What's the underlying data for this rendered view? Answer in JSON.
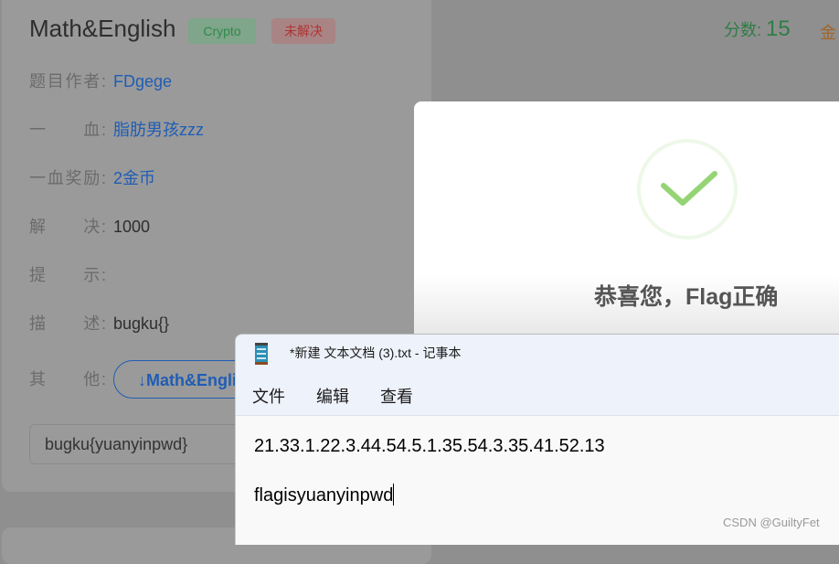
{
  "challenge": {
    "title": "Math&English",
    "category_badge": "Crypto",
    "status_badge": "未解决",
    "score_label": "分数:",
    "score_value": "15",
    "gold_label": "金",
    "fields": [
      {
        "label": "题目作者:",
        "value": "FDgege"
      },
      {
        "label": "一　　血:",
        "value": "脂肪男孩zzz"
      },
      {
        "label": "一血奖励:",
        "value": "2金币"
      },
      {
        "label": "解　　决:",
        "value": "1000"
      },
      {
        "label": "提　　示:",
        "value": ""
      },
      {
        "label": "描　　述:",
        "value": "bugku{}"
      },
      {
        "label": "其　　他:",
        "value": ""
      }
    ],
    "download_label": "↓Math&English",
    "flag_input_value": "bugku{yuanyinpwd}"
  },
  "modal": {
    "message": "恭喜您，Flag正确",
    "icon": "success-check-icon",
    "accent": "#95d475"
  },
  "notepad": {
    "title": "*新建 文本文档 (3).txt - 记事本",
    "menu": [
      "文件",
      "编辑",
      "查看"
    ],
    "lines": [
      "21.33.1.22.3.44.54.5.1.35.54.3.35.41.52.13",
      "flagisyuanyinpwd"
    ]
  },
  "watermark": "CSDN @GuiltyFet"
}
